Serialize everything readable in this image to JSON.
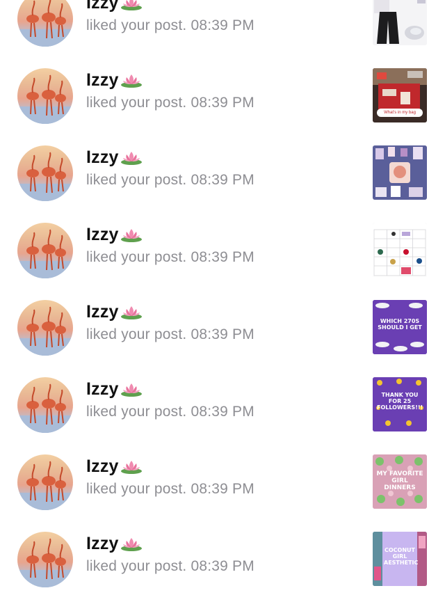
{
  "notifications": [
    {
      "user": "Izzy",
      "action": "liked your post.",
      "time": "08:39 PM",
      "thumb_caption": ""
    },
    {
      "user": "Izzy",
      "action": "liked your post.",
      "time": "08:39 PM",
      "thumb_caption": "What's in my bag"
    },
    {
      "user": "Izzy",
      "action": "liked your post.",
      "time": "08:39 PM",
      "thumb_caption": ""
    },
    {
      "user": "Izzy",
      "action": "liked your post.",
      "time": "08:39 PM",
      "thumb_caption": ""
    },
    {
      "user": "Izzy",
      "action": "liked your post.",
      "time": "08:39 PM",
      "thumb_caption": "WHICH 270S SHOULD I GET"
    },
    {
      "user": "Izzy",
      "action": "liked your post.",
      "time": "08:39 PM",
      "thumb_caption": "THANK YOU FOR 25 FOLLOWERS!!!"
    },
    {
      "user": "Izzy",
      "action": "liked your post.",
      "time": "08:39 PM",
      "thumb_caption": "MY FAVORITE GIRL DINNERS"
    },
    {
      "user": "Izzy",
      "action": "liked your post.",
      "time": "08:39 PM",
      "thumb_caption": "COCONUT GIRL AESTHETIC"
    }
  ],
  "icons": {
    "name_emoji": "lotus-icon"
  },
  "colors": {
    "name_text": "#111111",
    "secondary_text": "#8e8e93",
    "purple_thumb": "#6a3fb3",
    "pink_thumb": "#d9a1b6",
    "lavender_thumb": "#c8b6f0"
  }
}
